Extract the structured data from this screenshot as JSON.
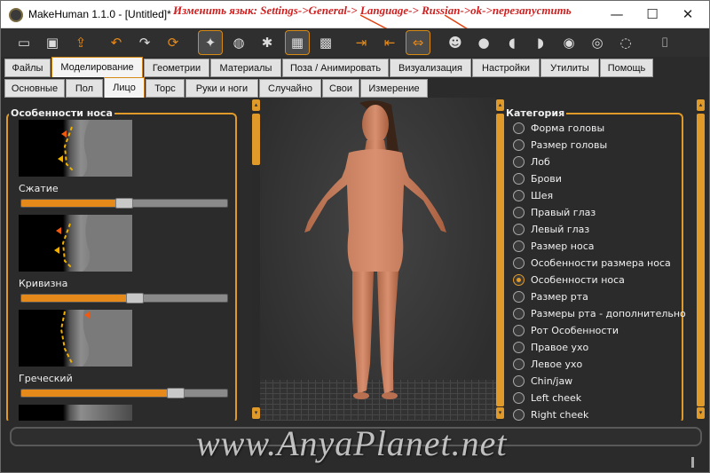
{
  "title_bar": {
    "app_title": "MakeHuman 1.1.0 - [Untitled]*",
    "annotation": "Изменить язык: Settings->General-> Language-> Russian->ok->перезапустить",
    "minimize": "—",
    "maximize": "☐",
    "close": "✕"
  },
  "toolbar": {
    "buttons": [
      {
        "name": "new-icon",
        "glyph": "▭"
      },
      {
        "name": "save-icon",
        "glyph": "▣"
      },
      {
        "name": "export-icon",
        "glyph": "⇪"
      },
      {
        "name": "undo-icon",
        "glyph": "↶"
      },
      {
        "name": "redo-icon",
        "glyph": "↷"
      },
      {
        "name": "reset-icon",
        "glyph": "⟳"
      },
      {
        "name": "smooth-icon",
        "glyph": "✦"
      },
      {
        "name": "wireframe-icon",
        "glyph": "◍"
      },
      {
        "name": "pose-icon",
        "glyph": "✱"
      },
      {
        "name": "grid-icon",
        "glyph": "▦"
      },
      {
        "name": "checker-icon",
        "glyph": "▩"
      },
      {
        "name": "symmetry-right-icon",
        "glyph": "⇥"
      },
      {
        "name": "symmetry-left-icon",
        "glyph": "⇤"
      },
      {
        "name": "symmetry-icon",
        "glyph": "⇔"
      },
      {
        "name": "front-view-icon",
        "glyph": "☻"
      },
      {
        "name": "back-view-icon",
        "glyph": "●"
      },
      {
        "name": "left-view-icon",
        "glyph": "◖"
      },
      {
        "name": "right-view-icon",
        "glyph": "◗"
      },
      {
        "name": "top-view-icon",
        "glyph": "◉"
      },
      {
        "name": "bottom-view-icon",
        "glyph": "◎"
      },
      {
        "name": "reset-camera-icon",
        "glyph": "◌"
      },
      {
        "name": "screenshot-icon",
        "glyph": "⌷"
      }
    ]
  },
  "main_tabs": [
    {
      "label": "Файлы"
    },
    {
      "label": "Моделирование"
    },
    {
      "label": "Геометрии"
    },
    {
      "label": "Материалы"
    },
    {
      "label": "Поза / Анимировать"
    },
    {
      "label": "Визуализация"
    },
    {
      "label": "Настройки"
    },
    {
      "label": "Утилиты"
    },
    {
      "label": "Помощь"
    }
  ],
  "sub_tabs": [
    {
      "label": "Основные"
    },
    {
      "label": "Пол"
    },
    {
      "label": "Лицо"
    },
    {
      "label": "Торс"
    },
    {
      "label": "Руки и ноги"
    },
    {
      "label": "Случайно"
    },
    {
      "label": "Свои"
    },
    {
      "label": "Измерение"
    }
  ],
  "left_panel": {
    "title": "Особенности носа",
    "sliders": [
      {
        "label": "Сжатие",
        "value": 0.5
      },
      {
        "label": "Кривизна",
        "value": 0.55
      },
      {
        "label": "Греческий",
        "value": 0.75
      }
    ]
  },
  "right_panel": {
    "title": "Категория",
    "items": [
      {
        "label": "Форма головы",
        "checked": false
      },
      {
        "label": "Размер головы",
        "checked": false
      },
      {
        "label": "Лоб",
        "checked": false
      },
      {
        "label": "Брови",
        "checked": false
      },
      {
        "label": "Шея",
        "checked": false
      },
      {
        "label": "Правый глаз",
        "checked": false
      },
      {
        "label": "Левый глаз",
        "checked": false
      },
      {
        "label": "Размер носа",
        "checked": false
      },
      {
        "label": "Особенности размера носа",
        "checked": false
      },
      {
        "label": "Особенности носа",
        "checked": true
      },
      {
        "label": "Размер рта",
        "checked": false
      },
      {
        "label": "Размеры рта - дополнительно",
        "checked": false
      },
      {
        "label": "Рот Особенности",
        "checked": false
      },
      {
        "label": "Правое ухо",
        "checked": false
      },
      {
        "label": "Левое ухо",
        "checked": false
      },
      {
        "label": "Chin/jaw",
        "checked": false
      },
      {
        "label": "Left cheek",
        "checked": false
      },
      {
        "label": "Right cheek",
        "checked": false
      }
    ]
  },
  "watermark": "www.AnyaPlanet.net",
  "colors": {
    "accent": "#e09a2a",
    "background": "#2b2b2b",
    "annotation": "#d11f1f"
  }
}
